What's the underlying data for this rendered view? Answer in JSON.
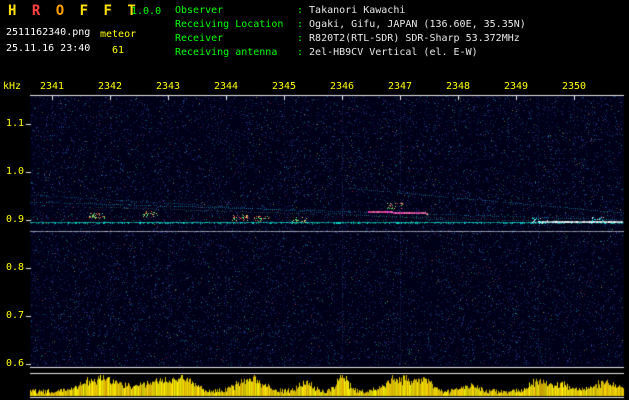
{
  "app": {
    "name": "HROFFT",
    "title_letters": [
      "H",
      "R",
      "O",
      "F",
      "F",
      "T"
    ],
    "title_styles": [
      "color:#ffe000",
      "color:#ff4040",
      "color:#ffa000",
      "color:#ffe000",
      "color:#ffe000",
      "color:#ffe000"
    ],
    "version": "1.0.0"
  },
  "capture": {
    "filename": "2511162340.png",
    "mode": "meteor",
    "datetime": "25.11.16 23:40",
    "echo_count": "61"
  },
  "observation": {
    "colon": ":",
    "rows": [
      {
        "label": "Observer",
        "value": "Takanori Kawachi"
      },
      {
        "label": "Receiving Location",
        "value": "Ogaki, Gifu, JAPAN (136.60E, 35.35N)"
      },
      {
        "label": "Receiver",
        "value": "R820T2(RTL-SDR) SDR-Sharp 53.372MHz"
      },
      {
        "label": "Receiving antenna",
        "value": "2el-HB9CV Vertical (el. E-W)"
      }
    ]
  },
  "axes": {
    "freq_unit": "kHz",
    "time_labels": [
      "2341",
      "2342",
      "2343",
      "2344",
      "2345",
      "2346",
      "2347",
      "2348",
      "2349",
      "2350"
    ],
    "freq_labels": [
      "1.1",
      "1.0",
      "0.9",
      "0.8",
      "0.7",
      "0.6"
    ]
  },
  "spectrogram": {
    "y_min_khz": 0.6,
    "y_max_khz": 1.15,
    "carrier_line_khz": 0.89,
    "features": [
      "continuous carrier line near 0.9 kHz",
      "slow diagonal doppler traces",
      "colored meteor echo bursts",
      "yellow audio level meter at bottom"
    ]
  },
  "colors": {
    "background": "#000000",
    "plot_background": "#000018",
    "axis_label": "#ffff00",
    "header_label": "#00ff00",
    "header_value": "#e8e8e8",
    "carrier_cyan": "#00ffe6",
    "meter_yellow": "#ffff00"
  }
}
